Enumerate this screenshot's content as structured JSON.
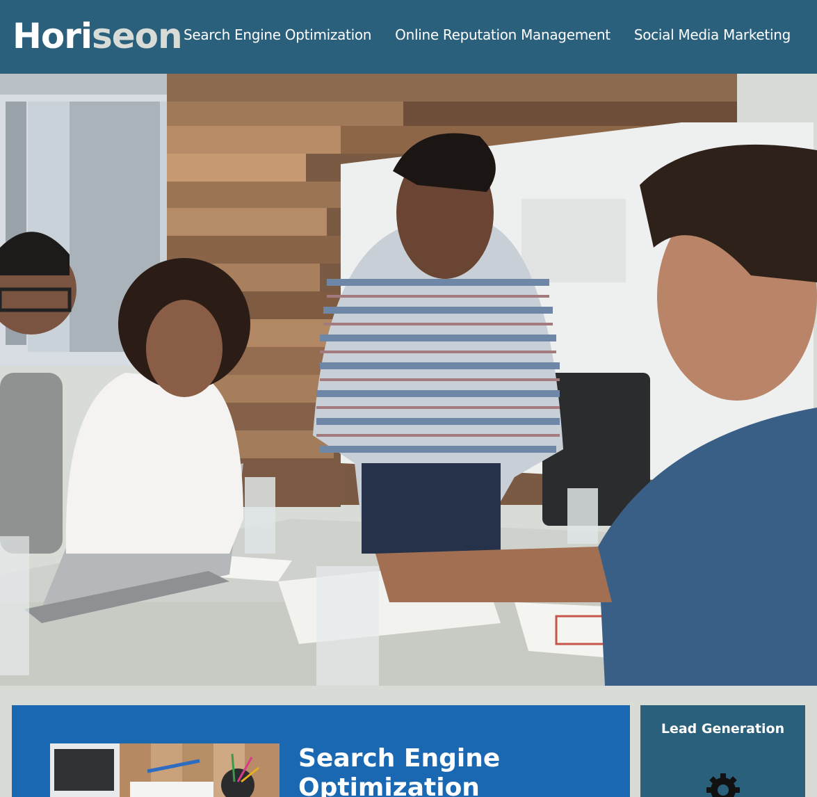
{
  "header": {
    "logo_part1": "Hori",
    "logo_part2": "seon",
    "nav": [
      {
        "label": "Search Engine Optimization"
      },
      {
        "label": "Online Reputation Management"
      },
      {
        "label": "Social Media Marketing"
      }
    ]
  },
  "hero": {
    "image": "team-meeting-photo"
  },
  "content": {
    "search_engine_optimization": {
      "title": "Search Engine Optimization",
      "image": "workspace-desk-photo"
    }
  },
  "benefits": {
    "lead_generation": {
      "title": "Lead Generation",
      "icon": "gear-icon"
    }
  },
  "colors": {
    "header_bg": "#2a607c",
    "page_bg": "#d9dcd6",
    "content_bg": "#1b68b2",
    "logo_accent": "#d9dcd6"
  }
}
